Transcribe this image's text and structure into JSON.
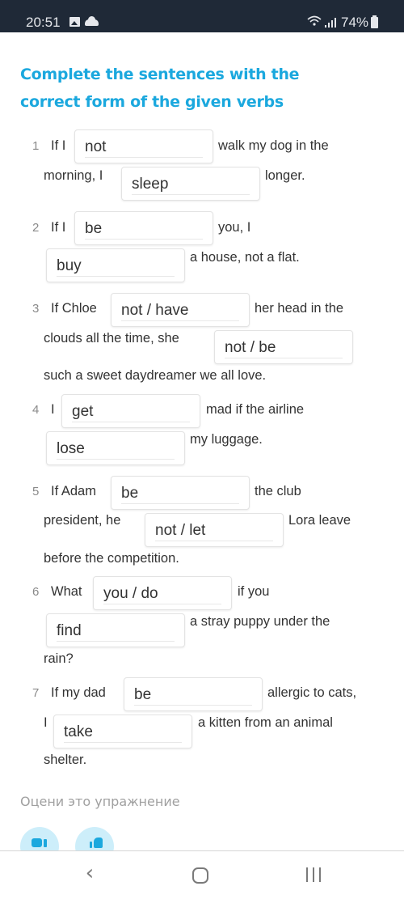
{
  "status_bar": {
    "time": "20:51",
    "icons": [
      "gallery-icon",
      "cloud-icon",
      "wifi-icon",
      "signal-icon",
      "battery-icon"
    ],
    "battery": "74%"
  },
  "exercise": {
    "title": "Complete the sentences with the correct form of the given verbs",
    "accent_color": "#1ba8de",
    "items": [
      {
        "number": "1",
        "parts": [
          "If I",
          "walk my dog in the",
          "morning, I",
          "longer."
        ],
        "answers": [
          "not",
          "sleep"
        ]
      },
      {
        "number": "2",
        "parts": [
          "If I",
          "you, I",
          "a house, not a flat."
        ],
        "answers": [
          "be",
          "buy"
        ]
      },
      {
        "number": "3",
        "parts": [
          "If Chloe",
          "her head in the",
          "clouds all the time, she",
          "such a sweet daydreamer we all love."
        ],
        "answers": [
          "not / have",
          "not / be"
        ]
      },
      {
        "number": "4",
        "parts": [
          "I",
          "mad if the airline",
          "my luggage."
        ],
        "answers": [
          "get",
          "lose"
        ]
      },
      {
        "number": "5",
        "parts": [
          "If Adam",
          "the club",
          "president, he",
          "Lora leave",
          "before the competition."
        ],
        "answers": [
          "be",
          "not / let"
        ]
      },
      {
        "number": "6",
        "parts": [
          "What",
          "if you",
          "a stray puppy under the",
          "rain?"
        ],
        "answers": [
          "you / do",
          "find"
        ]
      },
      {
        "number": "7",
        "parts": [
          "If my dad",
          "allergic to cats,",
          "I",
          "a kitten from an animal",
          "shelter."
        ],
        "answers": [
          "be",
          "take"
        ]
      }
    ]
  },
  "rating": {
    "label": "Оцени это упражнение",
    "buttons": [
      {
        "icon": "thumbs-down-icon"
      },
      {
        "icon": "thumbs-up-icon"
      }
    ]
  },
  "nav_bar": {
    "back_glyph": "‹",
    "icons": [
      "back-icon",
      "home-icon",
      "recent-apps-icon"
    ]
  }
}
